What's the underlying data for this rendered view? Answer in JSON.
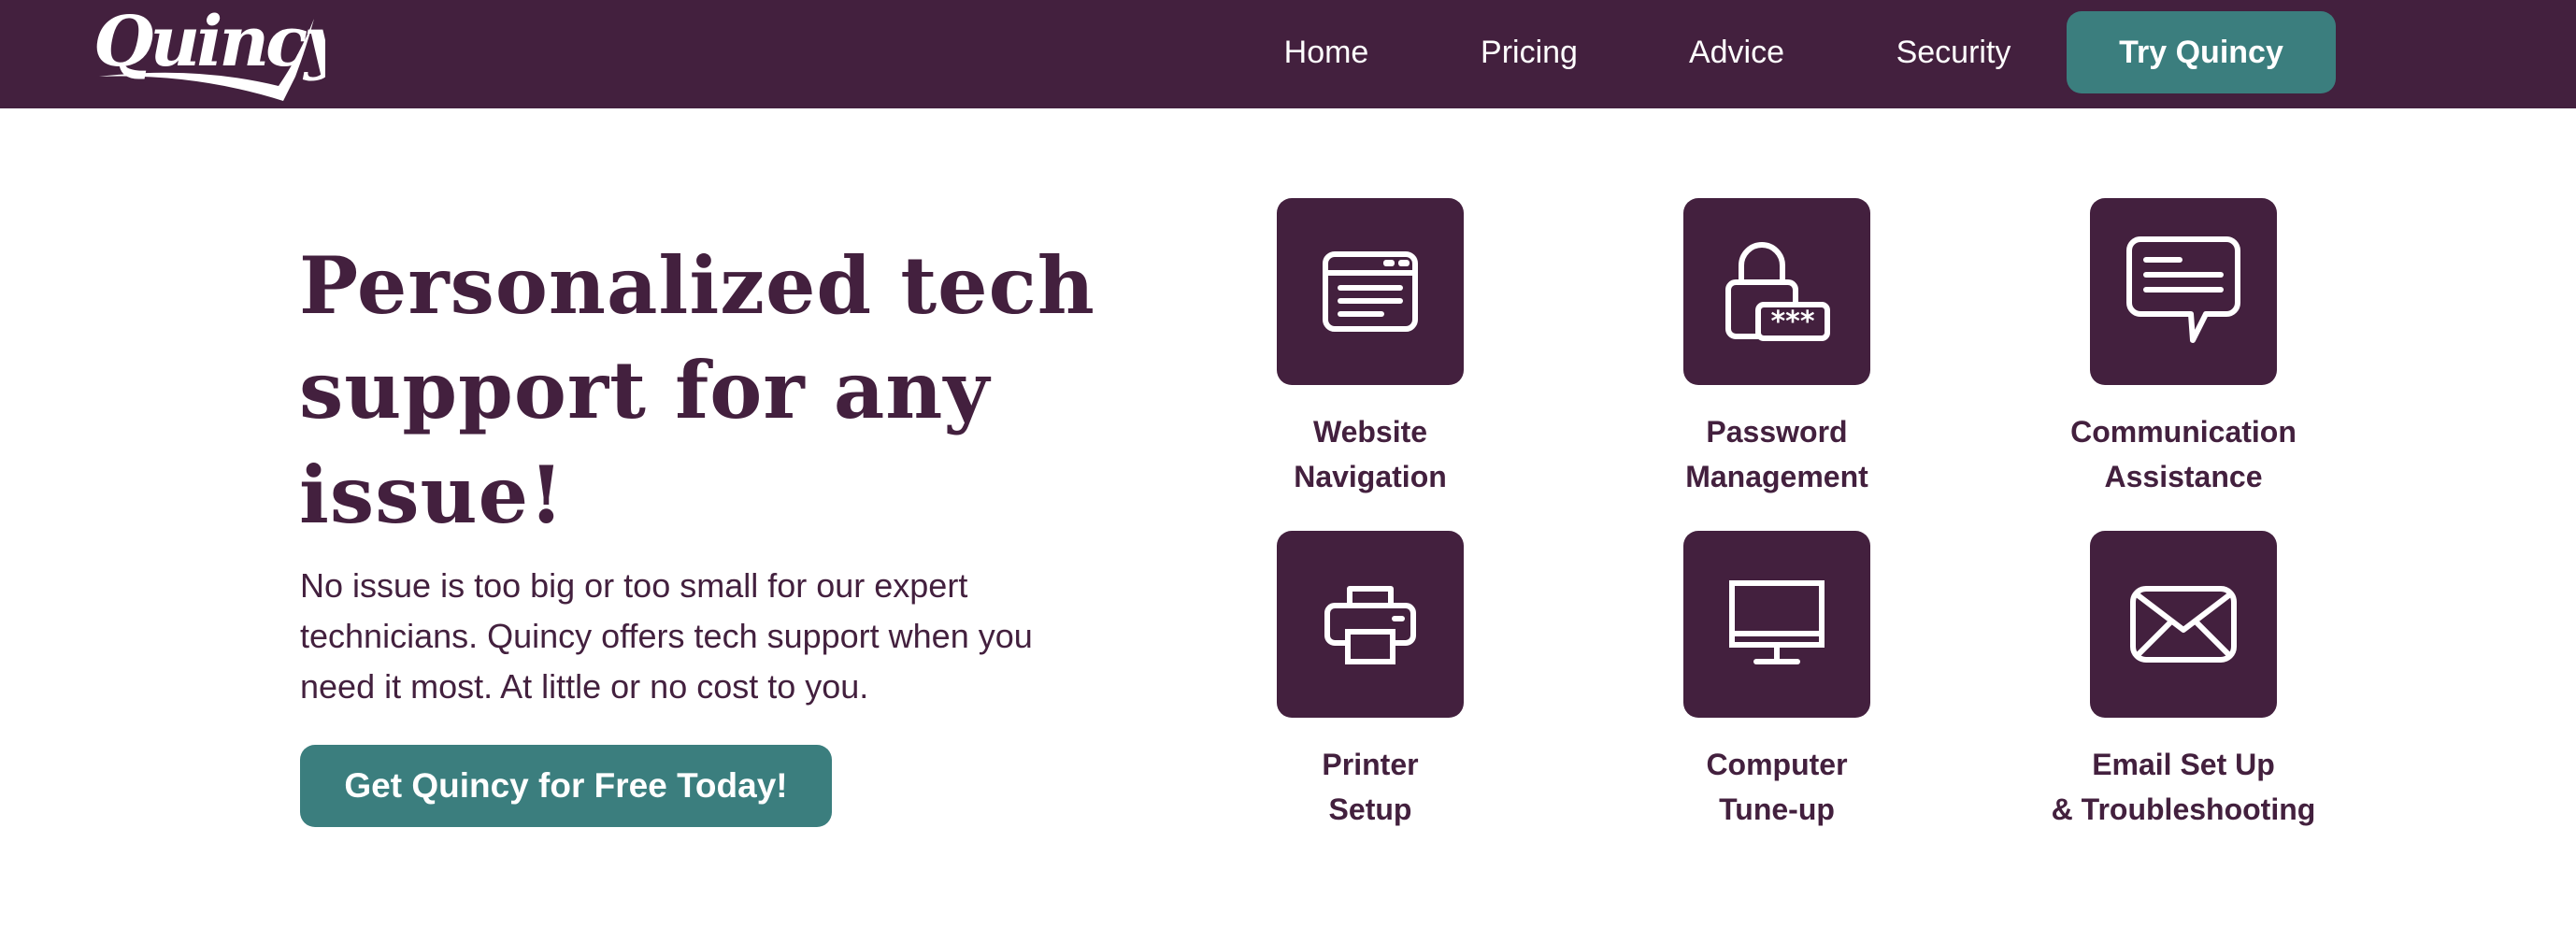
{
  "header": {
    "logo_text": "Quincy",
    "nav": [
      {
        "label": "Home"
      },
      {
        "label": "Pricing"
      },
      {
        "label": "Advice"
      },
      {
        "label": "Security"
      }
    ],
    "cta_label": "Try Quincy"
  },
  "hero": {
    "title": "Personalized tech support for any issue!",
    "description": "No issue is too big or too small for our expert technicians. Quincy offers tech support when you need it most. At little or no cost to you.",
    "button_label": "Get Quincy for Free Today!"
  },
  "services": [
    {
      "icon": "browser-window-icon",
      "line1": "Website",
      "line2": "Navigation"
    },
    {
      "icon": "padlock-password-icon",
      "line1": "Password",
      "line2": "Management"
    },
    {
      "icon": "chat-bubble-icon",
      "line1": "Communication",
      "line2": "Assistance"
    },
    {
      "icon": "printer-icon",
      "line1": "Printer",
      "line2": "Setup"
    },
    {
      "icon": "monitor-icon",
      "line1": "Computer",
      "line2": "Tune-up"
    },
    {
      "icon": "envelope-icon",
      "line1": "Email Set Up",
      "line2": "& Troubleshooting"
    }
  ],
  "colors": {
    "brand_plum": "#43203e",
    "accent_teal": "#3b7e7e",
    "background": "#ffffff"
  }
}
